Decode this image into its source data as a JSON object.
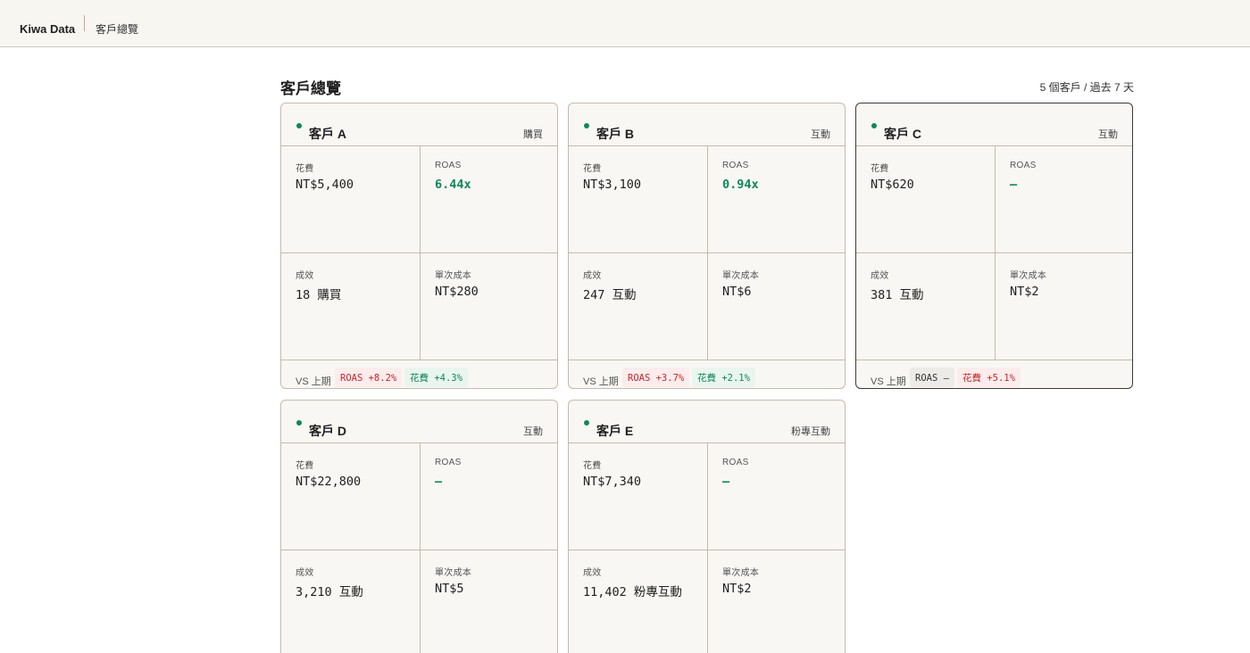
{
  "topbar": {
    "brand": "Kiwa Data",
    "breadcrumb": "客戶總覽"
  },
  "page": {
    "title": "客戶總覽",
    "meta": "5 個客戶 / 過去 7 天"
  },
  "labels": {
    "spend": "花費",
    "roas": "ROAS",
    "results": "成效",
    "cpa": "單次成本",
    "vs": "VS 上期"
  },
  "colors": {
    "status_dot": "#12875a",
    "positive": "#12875a",
    "negative": "#c6272b",
    "border": "#c9b9a8",
    "background": "#f8f7f3"
  },
  "clients": [
    {
      "name": "客戶 A",
      "tag": "購買",
      "spend": "NT$5,400",
      "roas": "6.44x",
      "results": "18 購買",
      "cpa": "NT$280",
      "compare": [
        {
          "text": "ROAS +8.2%",
          "tone": "red"
        },
        {
          "text": "花費 +4.3%",
          "tone": "green"
        }
      ]
    },
    {
      "name": "客戶 B",
      "tag": "互動",
      "spend": "NT$3,100",
      "roas": "0.94x",
      "results": "247 互動",
      "cpa": "NT$6",
      "compare": [
        {
          "text": "ROAS +3.7%",
          "tone": "red"
        },
        {
          "text": "花費 +2.1%",
          "tone": "green"
        }
      ]
    },
    {
      "name": "客戶 C",
      "tag": "互動",
      "spend": "NT$620",
      "roas": "—",
      "results": "381 互動",
      "cpa": "NT$2",
      "compare": [
        {
          "text": "ROAS —",
          "tone": "gray"
        },
        {
          "text": "花費 +5.1%",
          "tone": "red"
        }
      ]
    },
    {
      "name": "客戶 D",
      "tag": "互動",
      "spend": "NT$22,800",
      "roas": "—",
      "results": "3,210 互動",
      "cpa": "NT$5"
    },
    {
      "name": "客戶 E",
      "tag": "粉專互動",
      "spend": "NT$7,340",
      "roas": "—",
      "results": "11,402 粉專互動",
      "cpa": "NT$2"
    }
  ]
}
